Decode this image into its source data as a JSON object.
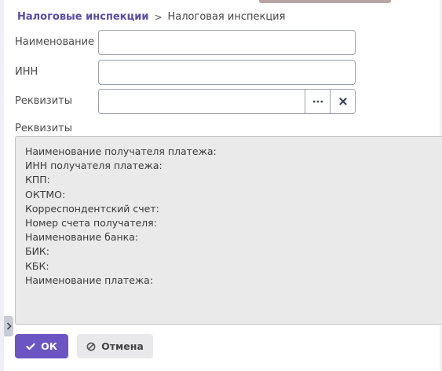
{
  "breadcrumb": {
    "parent": "Налоговые инспекции",
    "separator": ">",
    "current": "Налоговая инспекция"
  },
  "form": {
    "name_label": "Наименование",
    "name_value": "",
    "inn_label": "ИНН",
    "inn_value": "",
    "requisites_label": "Реквизиты",
    "requisites_value": ""
  },
  "details": {
    "label": "Реквизиты",
    "lines": [
      "Наименование получателя платежа:",
      "ИНН получателя платежа:",
      "КПП:",
      "ОКТМО:",
      "Корреспондентский счет:",
      "Номер счета получателя:",
      "Наименование банка:",
      "БИК:",
      "КБК:",
      "Наименование платежа:"
    ]
  },
  "actions": {
    "ok_label": "ОК",
    "cancel_label": "Отмена"
  },
  "icons": {
    "select": "ellipsis-icon",
    "clear": "close-icon",
    "ok": "check-icon",
    "cancel": "cancel-circle-icon",
    "expander": "chevron-right-icon"
  },
  "colors": {
    "accent": "#6a55c2",
    "link": "#5b4aa8",
    "details_background": "#eaeaea"
  }
}
